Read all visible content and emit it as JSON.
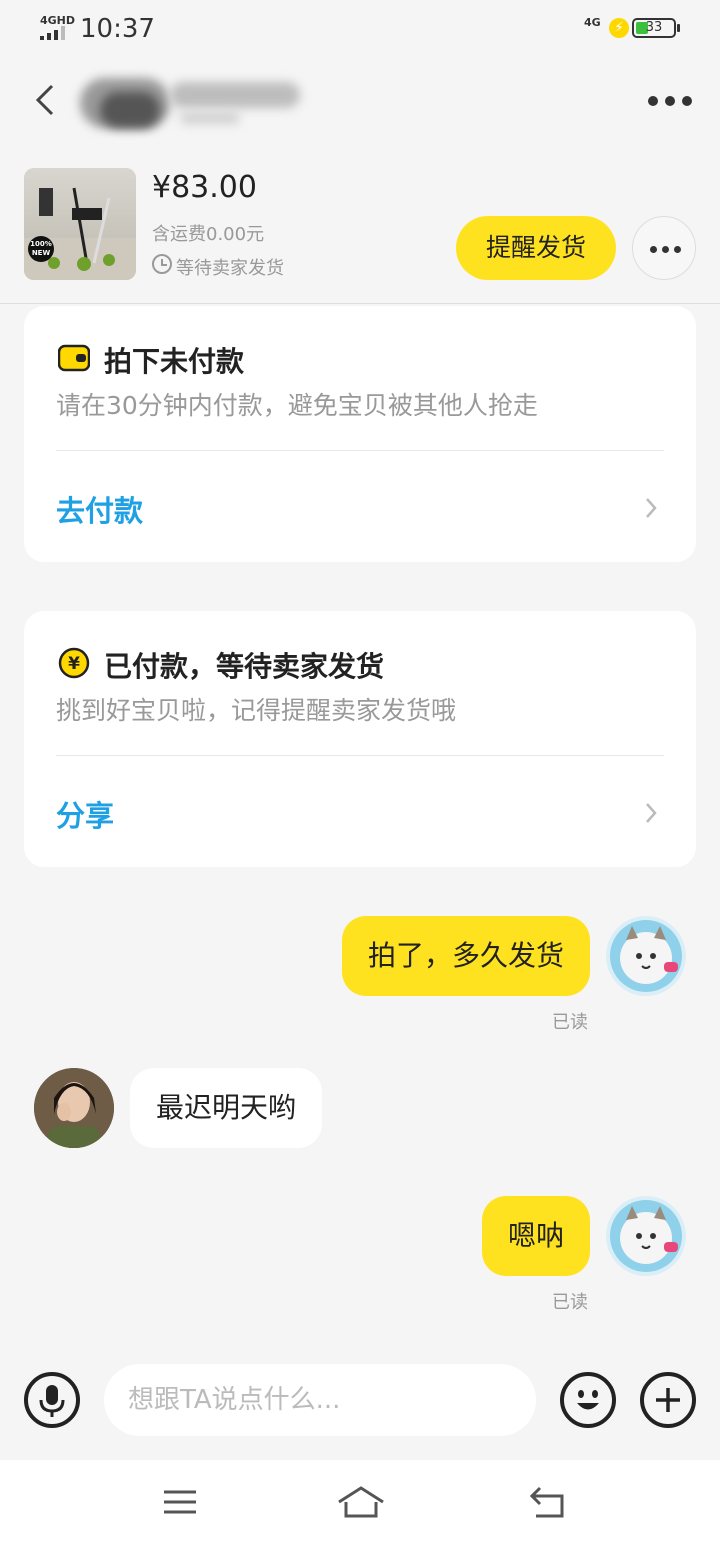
{
  "status_bar": {
    "network": "4GHD",
    "time": "10:37",
    "right_network": "4G",
    "battery": "33"
  },
  "header": {
    "seller_name_blurred": true,
    "back_icon": "chevron-left-icon",
    "menu_icon": "ellipsis-icon"
  },
  "product": {
    "price": "¥83.00",
    "shipping": "含运费0.00元",
    "status": "等待卖家发货",
    "thumb_badge": "100% NEW",
    "remind_button": "提醒发货"
  },
  "cards": [
    {
      "icon": "wallet-icon",
      "title": "拍下未付款",
      "subtitle": "请在30分钟内付款，避免宝贝被其他人抢走",
      "action": "去付款"
    },
    {
      "icon": "yen-coin-icon",
      "title": "已付款，等待卖家发货",
      "subtitle": "挑到好宝贝啦，记得提醒卖家发货哦",
      "action": "分享"
    }
  ],
  "messages": [
    {
      "from": "me",
      "text": "拍了，多久发货",
      "read": "已读"
    },
    {
      "from": "seller",
      "text": "最迟明天哟"
    },
    {
      "from": "me",
      "text": "嗯呐",
      "read": "已读"
    }
  ],
  "input": {
    "placeholder": "想跟TA说点什么..."
  },
  "colors": {
    "accent_yellow": "#ffe21f",
    "link_blue": "#1fa0e4",
    "background": "#f5f5f5"
  }
}
